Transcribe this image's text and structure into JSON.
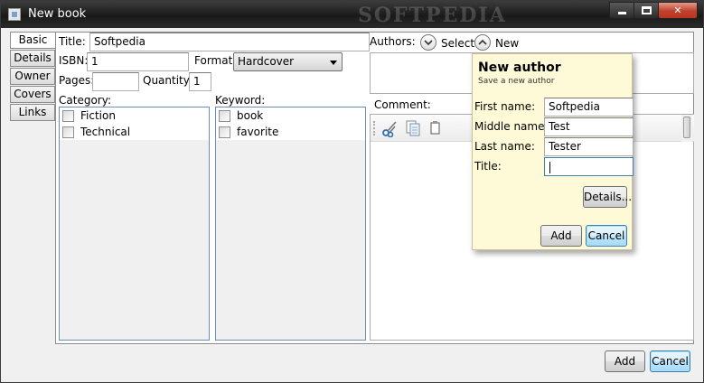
{
  "window": {
    "title": "New book",
    "watermark": "SOFTPEDIA"
  },
  "tabs": [
    {
      "label": "Basic"
    },
    {
      "label": "Details"
    },
    {
      "label": "Owner"
    },
    {
      "label": "Covers"
    },
    {
      "label": "Links"
    }
  ],
  "form": {
    "title_label": "Title:",
    "title_value": "Softpedia",
    "isbn_label": "ISBN:",
    "isbn_value": "1",
    "format_label": "Format:",
    "format_value": "Hardcover",
    "pages_label": "Pages:",
    "pages_value": "",
    "quantity_label": "Quantity:",
    "quantity_value": "1",
    "category_label": "Category:",
    "categories": [
      "Fiction",
      "Technical"
    ],
    "keyword_label": "Keyword:",
    "keywords": [
      "book",
      "favorite"
    ],
    "authors_label": "Authors:",
    "select_label": "Select",
    "new_label": "New",
    "comment_label": "Comment:"
  },
  "popup": {
    "title": "New author",
    "subtitle": "Save a new author",
    "first_name_label": "First name:",
    "first_name_value": "Softpedia",
    "middle_name_label": "Middle name:",
    "middle_name_value": "Test",
    "last_name_label": "Last name:",
    "last_name_value": "Tester",
    "title_label": "Title:",
    "title_value": "",
    "details_button": "Details...",
    "add_button": "Add",
    "cancel_button": "Cancel"
  },
  "footer": {
    "add_button": "Add",
    "cancel_button": "Cancel"
  },
  "icons": [
    "app-icon",
    "scissors-icon",
    "copy-icon",
    "paste-icon",
    "chevron-down-icon",
    "chevron-up-icon"
  ]
}
